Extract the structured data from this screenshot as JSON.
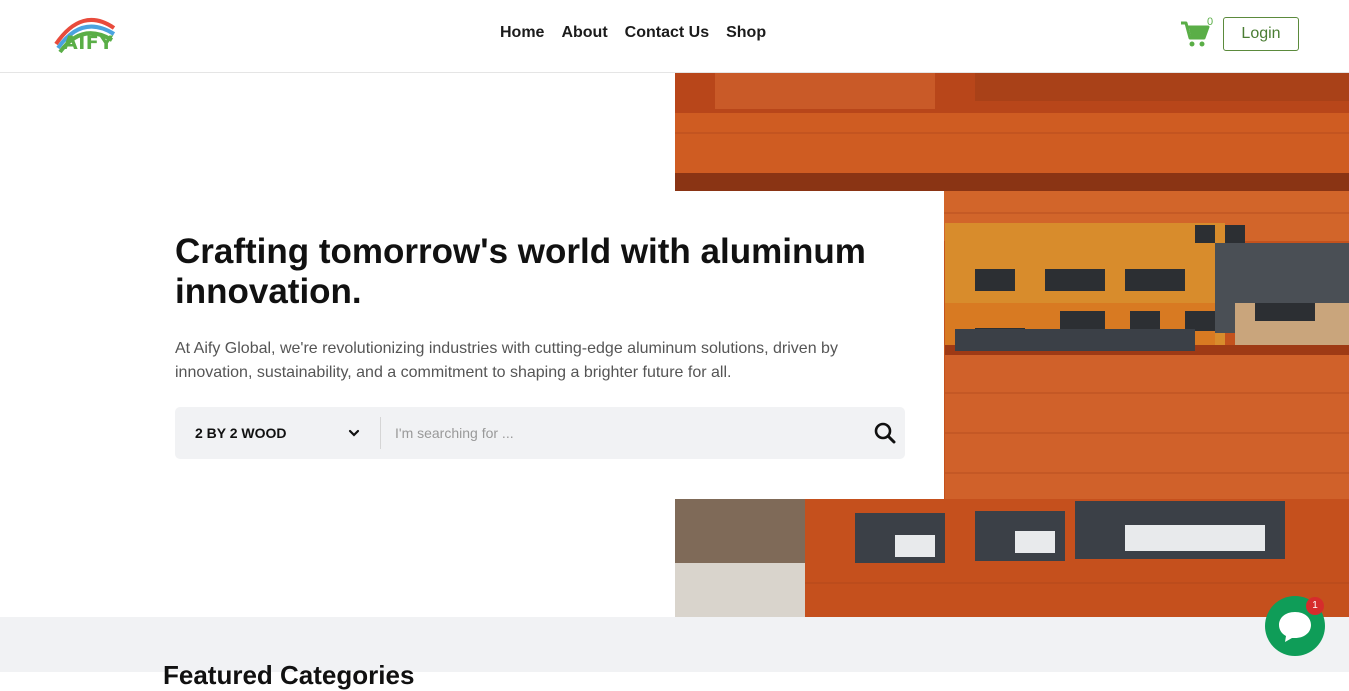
{
  "brand": {
    "logo_text": "AIFY"
  },
  "nav": {
    "items": [
      {
        "label": "Home"
      },
      {
        "label": "About"
      },
      {
        "label": "Contact Us"
      },
      {
        "label": "Shop"
      }
    ]
  },
  "cart": {
    "count": "0"
  },
  "auth": {
    "login_label": "Login"
  },
  "hero": {
    "title": "Crafting tomorrow's world with aluminum innovation.",
    "description": "At Aify Global, we're revolutionizing industries with cutting-edge aluminum solutions, driven by innovation, sustainability, and a commitment to shaping a brighter future for all."
  },
  "search": {
    "category_selected": "2 BY 2 WOOD",
    "placeholder": "I'm searching for ..."
  },
  "section_peek": {
    "title": "Featured Categories"
  },
  "chat": {
    "badge_count": "1"
  },
  "colors": {
    "brand_green": "#5aae47",
    "chat_green": "#0f9d58",
    "roof_orange": "#c9531a"
  }
}
